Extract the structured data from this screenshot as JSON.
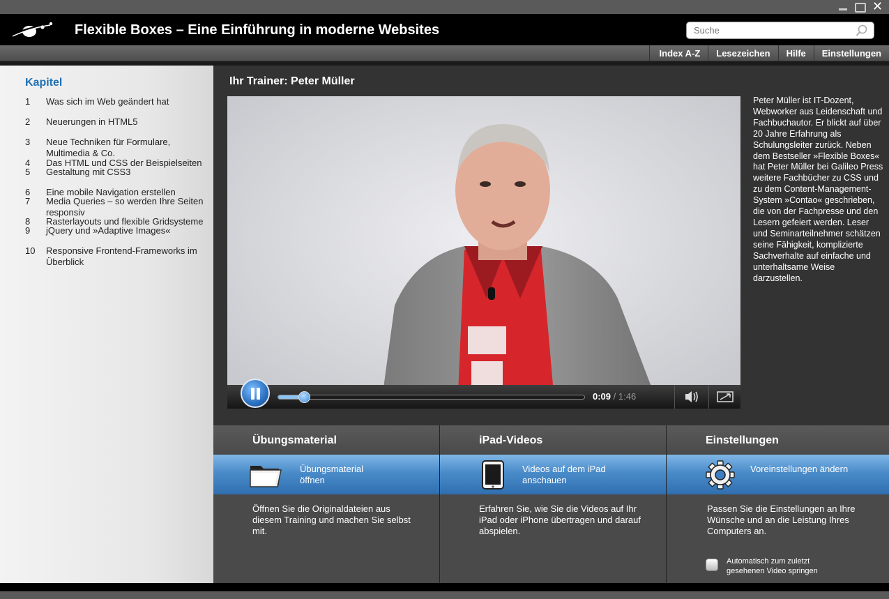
{
  "app": {
    "title": "Flexible Boxes – Eine Einführung in moderne Websites"
  },
  "search": {
    "placeholder": "Suche",
    "value": ""
  },
  "nav": [
    "Index A-Z",
    "Lesezeichen",
    "Hilfe",
    "Einstellungen"
  ],
  "sidebar": {
    "heading": "Kapitel",
    "chapters": [
      {
        "num": "1",
        "title": "Was sich im Web geändert hat"
      },
      {
        "num": "2",
        "title": "Neuerungen in HTML5"
      },
      {
        "num": "3",
        "title": "Neue Techniken für Formulare, Multimedia & Co."
      },
      {
        "num": "4",
        "title": "Das HTML und CSS der Beispielseiten"
      },
      {
        "num": "5",
        "title": "Gestaltung mit CSS3"
      },
      {
        "num": "6",
        "title": "Eine mobile Navigation erstellen"
      },
      {
        "num": "7",
        "title": "Media Queries – so werden Ihre Seiten responsiv"
      },
      {
        "num": "8",
        "title": "Rasterlayouts und flexible Gridsysteme"
      },
      {
        "num": "9",
        "title": "jQuery und »Adaptive Images«"
      },
      {
        "num": "10",
        "title": "Responsive Frontend-Frameworks im Überblick"
      }
    ]
  },
  "trainer": {
    "title": "Ihr Trainer: Peter Müller",
    "bio": "Peter Müller ist IT-Dozent, Webworker aus Leidenschaft und Fachbuchautor. Er blickt auf über 20 Jahre Erfahrung als Schulungsleiter zurück. Neben dem Bestseller »Flexible Boxes« hat Peter Müller bei Galileo Press weitere Fachbücher zu CSS und zu dem Content-Management-System »Contao« geschrieben, die von der Fachpresse und den Lesern gefeiert werden. Leser und Seminarteilnehmer schätzen seine Fähigkeit, komplizierte Sachverhalte auf einfache und unterhaltsame Weise darzustellen."
  },
  "player": {
    "current_time": "0:09",
    "duration": "/ 1:46",
    "progress_fraction": 0.085
  },
  "panels": [
    {
      "title": "Übungsmaterial",
      "icon": "folder-icon",
      "action": "Übungsmaterial öffnen",
      "desc": "Öffnen Sie die Originaldateien aus diesem Training und machen Sie selbst mit."
    },
    {
      "title": "iPad-Videos",
      "icon": "ipad-icon",
      "action": "Videos auf dem iPad anschauen",
      "desc": "Erfahren Sie, wie Sie die Videos auf Ihr iPad oder iPhone übertragen und darauf abspielen."
    },
    {
      "title": "Einstellungen",
      "icon": "gear-icon",
      "action": "Voreinstellungen ändern",
      "desc": "Passen Sie die Einstellungen an Ihre Wünsche und an die Leistung Ihres Computers an.",
      "checkbox": {
        "label": "Automatisch zum zuletzt gesehenen Video springen",
        "checked": false
      }
    }
  ],
  "colors": {
    "accent": "#2270b3",
    "action_bar": "#4a8bc9",
    "title_bar": "#000000"
  }
}
